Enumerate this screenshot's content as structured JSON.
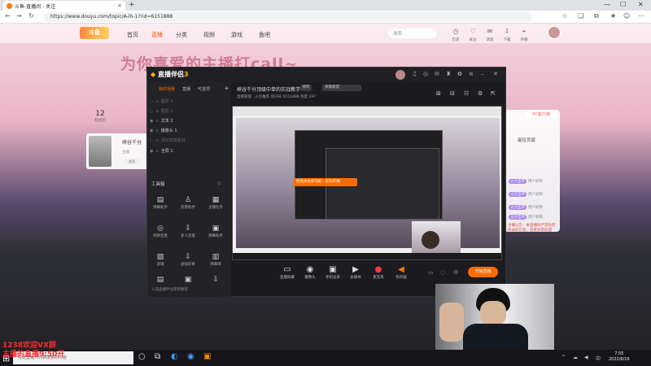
{
  "browser": {
    "tab_title": "斗鱼-直播间 - 关注",
    "tab_close": "×",
    "new_tab": "+",
    "url": "https://www.douyu.com/topic/A-lh-1?rid=6151888",
    "nav_icons": [
      "back-icon",
      "forward-icon",
      "refresh-icon"
    ]
  },
  "site": {
    "logo": "斗鱼",
    "nav": [
      "首页",
      "直播",
      "分类",
      "视频",
      "游戏",
      "鱼吧"
    ],
    "search_placeholder": "搜索",
    "header_labels": [
      "历史",
      "关注",
      "消息",
      "下载",
      "开播"
    ],
    "banner": "为你喜爱的主播打call~",
    "left_stat_number": "12",
    "left_stat_label": "粉丝团",
    "room_name": "峡谷千分",
    "room_sub": "主播",
    "room_btn": "关注",
    "pc_button": "PC客户端",
    "side_title": "最佳贡献",
    "side_rows": [
      "火力全开",
      "火力全开",
      "火力全开",
      "火力全开"
    ],
    "side_row_meta": "用户昵称",
    "red_text": "主播公告：本直播间严禁任何形式的引流，违者封禁处理"
  },
  "app": {
    "logo_main": "直播伴侣",
    "logo_suffix": "3",
    "tabs": [
      "我的场景",
      "直播",
      "可选项"
    ],
    "scenes": [
      {
        "label": "图层 1",
        "dim": true
      },
      {
        "label": "图层 2",
        "dim": true
      },
      {
        "label": "文本 1",
        "dim": false
      },
      {
        "label": "摄像头 1",
        "dim": false
      },
      {
        "label": "添加直播素材",
        "dim": true
      },
      {
        "label": "全屏 1",
        "dim": false
      }
    ],
    "tools_label": "工具箱",
    "tools": [
      "弹幕助手",
      "房管助手",
      "主播任务",
      "视频连麦",
      "多人连麦",
      "弹幕助手",
      "滤镜",
      "虚拟形象",
      "弹幕库",
      "小游戏",
      "礼物",
      "更多"
    ],
    "footer": "入选直播伴侣使用教程",
    "stream_title": "峡谷千分顶级中单的实战教学",
    "edit": "修改",
    "category": "英雄联盟",
    "meta": "直播管理 · 火热推荐    房间号 6151888    热度 197",
    "toast": "抢先体验新功能 · 即刻开播",
    "bottom_tools": [
      {
        "label": "直播屏幕",
        "icon": "▭"
      },
      {
        "label": "摄像头",
        "icon": "◉"
      },
      {
        "label": "手机投屏",
        "icon": "▣"
      },
      {
        "label": "多媒体",
        "icon": "▶"
      },
      {
        "label": "麦克风",
        "icon": "●"
      },
      {
        "label": "扬声器",
        "icon": "◀"
      }
    ],
    "go_live": "开始直播"
  },
  "overlay": {
    "line1": "1238欢迎VX群",
    "line2": "主播的直播9:50开"
  },
  "taskbar": {
    "search_placeholder": "在这里输入你要搜索的内容",
    "time": "7:55",
    "date": "2022/8/16"
  }
}
